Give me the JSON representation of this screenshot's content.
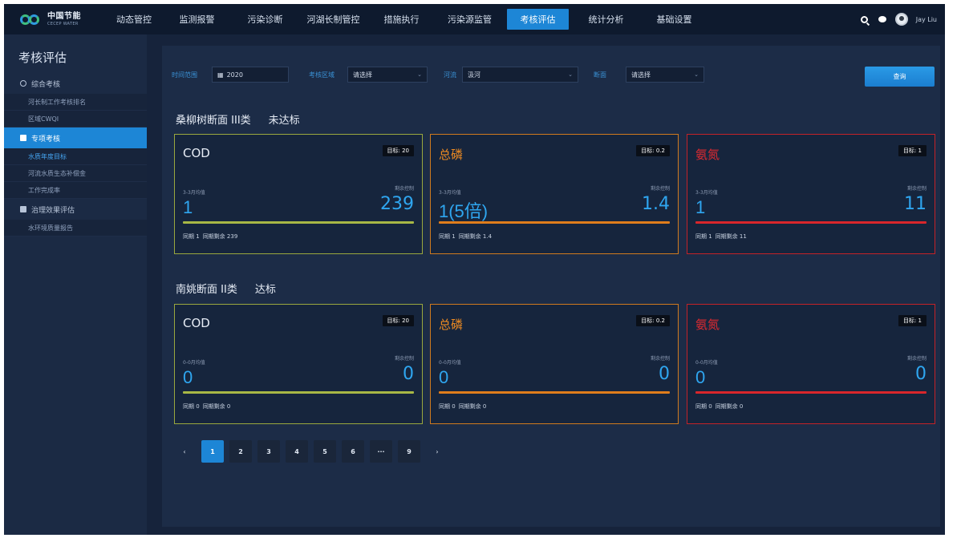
{
  "app": {
    "logo_cn": "中国节能",
    "logo_en": "CECEP WATER"
  },
  "nav": {
    "items": [
      {
        "label": "动态管控"
      },
      {
        "label": "监测报警"
      },
      {
        "label": "污染诊断"
      },
      {
        "label": "河湖长制管控"
      },
      {
        "label": "措施执行"
      },
      {
        "label": "污染源监管"
      },
      {
        "label": "考核评估"
      },
      {
        "label": "统计分析"
      },
      {
        "label": "基础设置"
      }
    ],
    "active_index": 6,
    "username": "Jay Liu"
  },
  "sidebar": {
    "title": "考核评估",
    "group1": {
      "label": "综合考核"
    },
    "group1_items": [
      {
        "label": "河长制工作考核排名"
      },
      {
        "label": "区域CWQI"
      }
    ],
    "group2": {
      "label": "专项考核"
    },
    "group2_items": [
      {
        "label": "水质年度目标"
      },
      {
        "label": "河流水质生态补偿金"
      },
      {
        "label": "工作完成率"
      }
    ],
    "group3": {
      "label": "治理效果评估"
    },
    "group3_items": [
      {
        "label": "水环境质量报告"
      }
    ]
  },
  "filters": {
    "time_label": "时间范围",
    "time_value": "2020",
    "area_label": "考核区域",
    "area_value": "请选择",
    "river_label": "河流",
    "river_value": "汲河",
    "section_label": "断面",
    "section_value": "请选择",
    "query_button": "查询"
  },
  "sections": [
    {
      "name": "桑柳树断面",
      "class": "III类",
      "status": "未达标",
      "cards": [
        {
          "name": "COD",
          "target": "目标: 20",
          "avg_label": "3-3月均值",
          "rem_label": "剩余控制",
          "avg": "1",
          "remaining": "239",
          "foot_a": "同期 1",
          "foot_b": "同期剩余 239",
          "color": "#a8b845"
        },
        {
          "name": "总磷",
          "target": "目标: 0.2",
          "avg_label": "3-3月均值",
          "rem_label": "剩余控制",
          "avg": "1(5倍)",
          "remaining": "1.4",
          "foot_a": "同期 1",
          "foot_b": "同期剩余 1.4",
          "color": "#e07d1c"
        },
        {
          "name": "氨氮",
          "target": "目标: 1",
          "avg_label": "3-3月均值",
          "rem_label": "剩余控制",
          "avg": "1",
          "remaining": "11",
          "foot_a": "同期 1",
          "foot_b": "同期剩余 11",
          "color": "#d9262b"
        }
      ]
    },
    {
      "name": "南姚断面",
      "class": "II类",
      "status": "达标",
      "cards": [
        {
          "name": "COD",
          "target": "目标: 20",
          "avg_label": "0-0月均值",
          "rem_label": "剩余控制",
          "avg": "0",
          "remaining": "0",
          "foot_a": "同期 0",
          "foot_b": "同期剩余 0",
          "color": "#a8b845"
        },
        {
          "name": "总磷",
          "target": "目标: 0.2",
          "avg_label": "0-0月均值",
          "rem_label": "剩余控制",
          "avg": "0",
          "remaining": "0",
          "foot_a": "同期 0",
          "foot_b": "同期剩余 0",
          "color": "#e07d1c"
        },
        {
          "name": "氨氮",
          "target": "目标: 1",
          "avg_label": "0-0月均值",
          "rem_label": "剩余控制",
          "avg": "0",
          "remaining": "0",
          "foot_a": "同期 0",
          "foot_b": "同期剩余 0",
          "color": "#d9262b"
        }
      ]
    }
  ],
  "pagination": {
    "prev": "‹",
    "next": "›",
    "pages": [
      "1",
      "2",
      "3",
      "4",
      "5",
      "6",
      "···",
      "9"
    ],
    "active": "1"
  }
}
